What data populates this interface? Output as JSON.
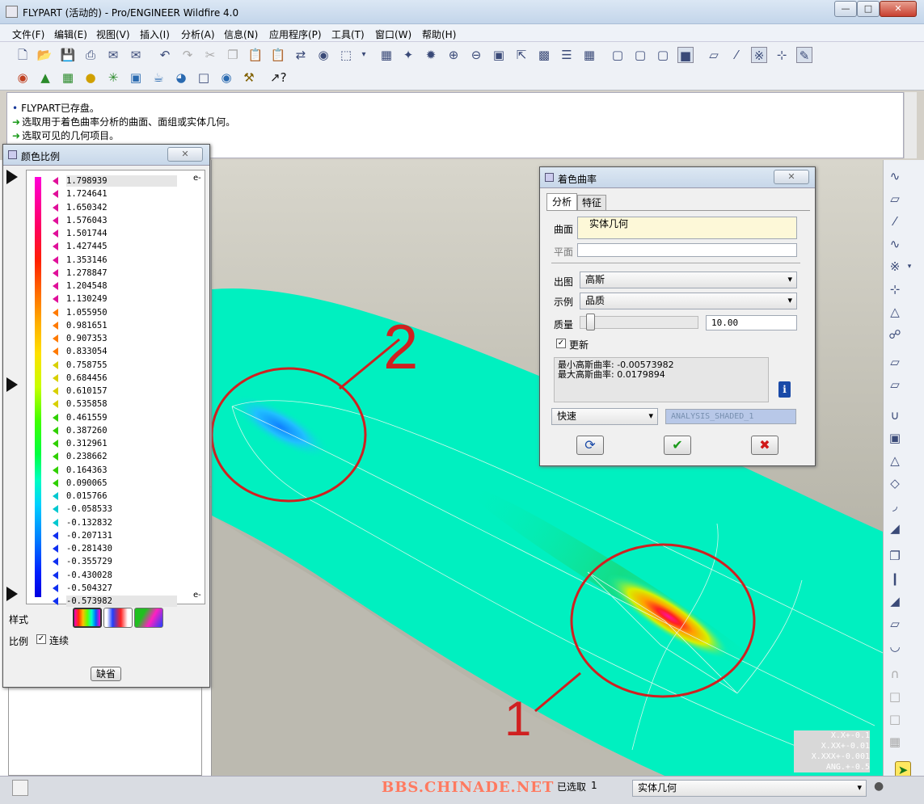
{
  "window": {
    "title": "FLYPART (活动的) - Pro/ENGINEER Wildfire 4.0"
  },
  "menu": [
    "文件(F)",
    "编辑(E)",
    "视图(V)",
    "插入(I)",
    "分析(A)",
    "信息(N)",
    "应用程序(P)",
    "工具(T)",
    "窗口(W)",
    "帮助(H)"
  ],
  "messages": [
    {
      "bullet": "•",
      "text": "FLYPART已存盘。"
    },
    {
      "bullet": "➜",
      "text": "选取用于着色曲率分析的曲面、面组或实体几何。"
    },
    {
      "bullet": "➜",
      "text": "选取可见的几何项目。"
    }
  ],
  "color_scale": {
    "title": "颜色比例",
    "values": [
      "1.798939",
      "1.724641",
      "1.650342",
      "1.576043",
      "1.501744",
      "1.427445",
      "1.353146",
      "1.278847",
      "1.204548",
      "1.130249",
      "1.055950",
      "0.981651",
      "0.907353",
      "0.833054",
      "0.758755",
      "0.684456",
      "0.610157",
      "0.535858",
      "0.461559",
      "0.387260",
      "0.312961",
      "0.238662",
      "0.164363",
      "0.090065",
      "0.015766",
      "-0.058533",
      "-0.132832",
      "-0.207131",
      "-0.281430",
      "-0.355729",
      "-0.430028",
      "-0.504327",
      "-0.573982"
    ],
    "exponent_top": "e-",
    "exponent_bottom": "e-",
    "style_label": "样式",
    "ratio_label": "比例",
    "continuous_label": "连续",
    "continuous_checked": true,
    "default_button": "缺省"
  },
  "shaded_dialog": {
    "title": "着色曲率",
    "tabs": [
      "分析",
      "特征"
    ],
    "surface_label": "曲面",
    "surface_value": "实体几何",
    "plane_label": "平面",
    "plane_value": "",
    "output_label": "出图",
    "output_value": "高斯",
    "display_label": "示例",
    "display_value": "品质",
    "quality_label": "质量",
    "quality_value": "10.00",
    "update_label": "更新",
    "update_checked": true,
    "result_line1": "最小高斯曲率: -0.00573982",
    "result_line2": "最大高斯曲率: 0.0179894",
    "mode_value": "快速",
    "name_value": "ANALYSIS_SHADED_1"
  },
  "annotations": {
    "label_1": "1",
    "label_2": "2"
  },
  "tolerance_box": [
    "X.X+-0.1",
    "X.XX+-0.01",
    "X.XXX+-0.001",
    "ANG.+-0.5"
  ],
  "status": {
    "selected_label": "已选取",
    "selected_count": "1",
    "filter_value": "实体几何",
    "watermark": "BBS.CHINADE.NET"
  },
  "colors": {
    "surface": "#00f0c0",
    "annotation": "#d02020",
    "titlebar": "#c7d7e9"
  }
}
